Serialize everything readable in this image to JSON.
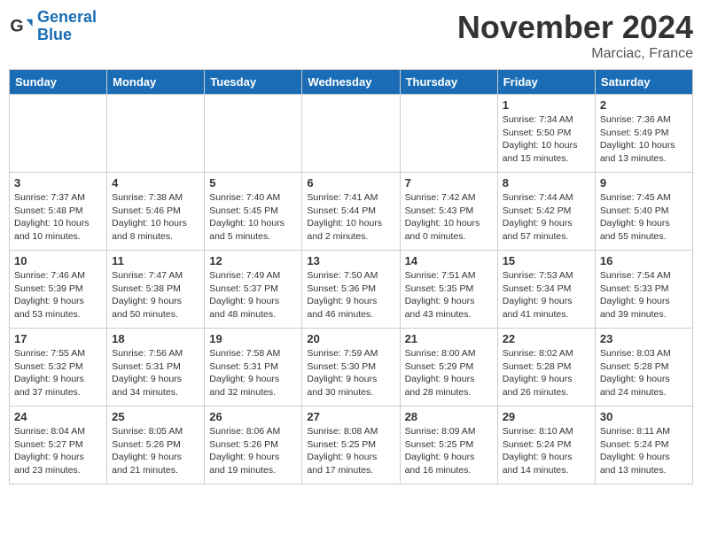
{
  "logo": {
    "line1": "General",
    "line2": "Blue"
  },
  "header": {
    "month": "November 2024",
    "location": "Marciac, France"
  },
  "weekdays": [
    "Sunday",
    "Monday",
    "Tuesday",
    "Wednesday",
    "Thursday",
    "Friday",
    "Saturday"
  ],
  "weeks": [
    [
      {
        "day": "",
        "info": ""
      },
      {
        "day": "",
        "info": ""
      },
      {
        "day": "",
        "info": ""
      },
      {
        "day": "",
        "info": ""
      },
      {
        "day": "",
        "info": ""
      },
      {
        "day": "1",
        "info": "Sunrise: 7:34 AM\nSunset: 5:50 PM\nDaylight: 10 hours and 15 minutes."
      },
      {
        "day": "2",
        "info": "Sunrise: 7:36 AM\nSunset: 5:49 PM\nDaylight: 10 hours and 13 minutes."
      }
    ],
    [
      {
        "day": "3",
        "info": "Sunrise: 7:37 AM\nSunset: 5:48 PM\nDaylight: 10 hours and 10 minutes."
      },
      {
        "day": "4",
        "info": "Sunrise: 7:38 AM\nSunset: 5:46 PM\nDaylight: 10 hours and 8 minutes."
      },
      {
        "day": "5",
        "info": "Sunrise: 7:40 AM\nSunset: 5:45 PM\nDaylight: 10 hours and 5 minutes."
      },
      {
        "day": "6",
        "info": "Sunrise: 7:41 AM\nSunset: 5:44 PM\nDaylight: 10 hours and 2 minutes."
      },
      {
        "day": "7",
        "info": "Sunrise: 7:42 AM\nSunset: 5:43 PM\nDaylight: 10 hours and 0 minutes."
      },
      {
        "day": "8",
        "info": "Sunrise: 7:44 AM\nSunset: 5:42 PM\nDaylight: 9 hours and 57 minutes."
      },
      {
        "day": "9",
        "info": "Sunrise: 7:45 AM\nSunset: 5:40 PM\nDaylight: 9 hours and 55 minutes."
      }
    ],
    [
      {
        "day": "10",
        "info": "Sunrise: 7:46 AM\nSunset: 5:39 PM\nDaylight: 9 hours and 53 minutes."
      },
      {
        "day": "11",
        "info": "Sunrise: 7:47 AM\nSunset: 5:38 PM\nDaylight: 9 hours and 50 minutes."
      },
      {
        "day": "12",
        "info": "Sunrise: 7:49 AM\nSunset: 5:37 PM\nDaylight: 9 hours and 48 minutes."
      },
      {
        "day": "13",
        "info": "Sunrise: 7:50 AM\nSunset: 5:36 PM\nDaylight: 9 hours and 46 minutes."
      },
      {
        "day": "14",
        "info": "Sunrise: 7:51 AM\nSunset: 5:35 PM\nDaylight: 9 hours and 43 minutes."
      },
      {
        "day": "15",
        "info": "Sunrise: 7:53 AM\nSunset: 5:34 PM\nDaylight: 9 hours and 41 minutes."
      },
      {
        "day": "16",
        "info": "Sunrise: 7:54 AM\nSunset: 5:33 PM\nDaylight: 9 hours and 39 minutes."
      }
    ],
    [
      {
        "day": "17",
        "info": "Sunrise: 7:55 AM\nSunset: 5:32 PM\nDaylight: 9 hours and 37 minutes."
      },
      {
        "day": "18",
        "info": "Sunrise: 7:56 AM\nSunset: 5:31 PM\nDaylight: 9 hours and 34 minutes."
      },
      {
        "day": "19",
        "info": "Sunrise: 7:58 AM\nSunset: 5:31 PM\nDaylight: 9 hours and 32 minutes."
      },
      {
        "day": "20",
        "info": "Sunrise: 7:59 AM\nSunset: 5:30 PM\nDaylight: 9 hours and 30 minutes."
      },
      {
        "day": "21",
        "info": "Sunrise: 8:00 AM\nSunset: 5:29 PM\nDaylight: 9 hours and 28 minutes."
      },
      {
        "day": "22",
        "info": "Sunrise: 8:02 AM\nSunset: 5:28 PM\nDaylight: 9 hours and 26 minutes."
      },
      {
        "day": "23",
        "info": "Sunrise: 8:03 AM\nSunset: 5:28 PM\nDaylight: 9 hours and 24 minutes."
      }
    ],
    [
      {
        "day": "24",
        "info": "Sunrise: 8:04 AM\nSunset: 5:27 PM\nDaylight: 9 hours and 23 minutes."
      },
      {
        "day": "25",
        "info": "Sunrise: 8:05 AM\nSunset: 5:26 PM\nDaylight: 9 hours and 21 minutes."
      },
      {
        "day": "26",
        "info": "Sunrise: 8:06 AM\nSunset: 5:26 PM\nDaylight: 9 hours and 19 minutes."
      },
      {
        "day": "27",
        "info": "Sunrise: 8:08 AM\nSunset: 5:25 PM\nDaylight: 9 hours and 17 minutes."
      },
      {
        "day": "28",
        "info": "Sunrise: 8:09 AM\nSunset: 5:25 PM\nDaylight: 9 hours and 16 minutes."
      },
      {
        "day": "29",
        "info": "Sunrise: 8:10 AM\nSunset: 5:24 PM\nDaylight: 9 hours and 14 minutes."
      },
      {
        "day": "30",
        "info": "Sunrise: 8:11 AM\nSunset: 5:24 PM\nDaylight: 9 hours and 13 minutes."
      }
    ]
  ]
}
